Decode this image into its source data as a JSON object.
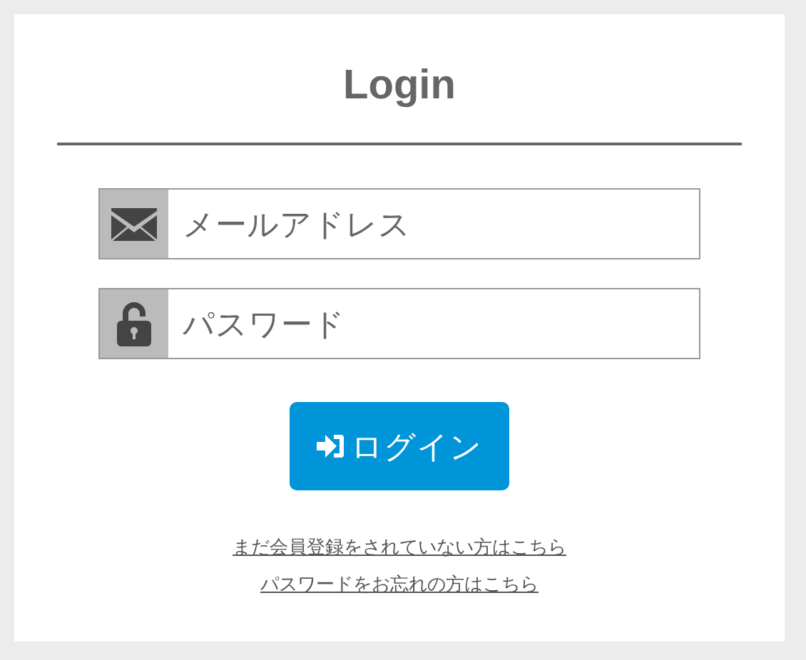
{
  "title": "Login",
  "fields": [
    {
      "kind": "email",
      "placeholder": "メールアドレス"
    },
    {
      "kind": "password",
      "placeholder": "パスワード"
    }
  ],
  "button": {
    "label": "ログイン"
  },
  "links": [
    "まだ会員登録をされていない方はこちら",
    "パスワードをお忘れの方はこちら"
  ]
}
